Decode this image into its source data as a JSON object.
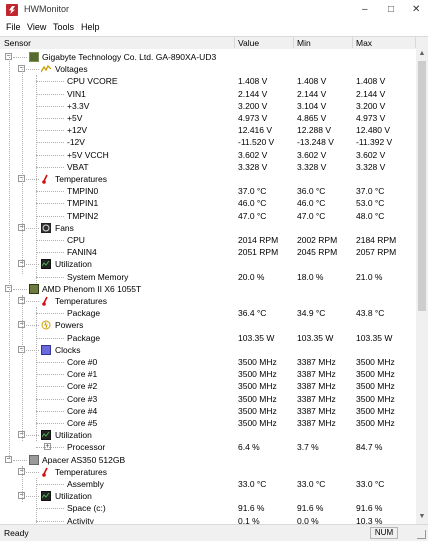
{
  "window": {
    "title": "HWMonitor"
  },
  "menu": [
    "File",
    "View",
    "Tools",
    "Help"
  ],
  "columns": {
    "sensor": "Sensor",
    "value": "Value",
    "min": "Min",
    "max": "Max"
  },
  "rows": [
    {
      "level": 1,
      "icon": "motherboard-icon",
      "label": "Gigabyte Technology Co. Ltd. GA-890XA-UD3",
      "value": "",
      "min": "",
      "max": "",
      "toggle": "–"
    },
    {
      "level": 2,
      "icon": "voltage-icon",
      "label": "Voltages",
      "value": "",
      "min": "",
      "max": "",
      "toggle": "–"
    },
    {
      "level": 3,
      "icon": "",
      "label": "CPU VCORE",
      "value": "1.408 V",
      "min": "1.408 V",
      "max": "1.408 V"
    },
    {
      "level": 3,
      "icon": "",
      "label": "VIN1",
      "value": "2.144 V",
      "min": "2.144 V",
      "max": "2.144 V"
    },
    {
      "level": 3,
      "icon": "",
      "label": "+3.3V",
      "value": "3.200 V",
      "min": "3.104 V",
      "max": "3.200 V"
    },
    {
      "level": 3,
      "icon": "",
      "label": "+5V",
      "value": "4.973 V",
      "min": "4.865 V",
      "max": "4.973 V"
    },
    {
      "level": 3,
      "icon": "",
      "label": "+12V",
      "value": "12.416 V",
      "min": "12.288 V",
      "max": "12.480 V"
    },
    {
      "level": 3,
      "icon": "",
      "label": "-12V",
      "value": "-11.520 V",
      "min": "-13.248 V",
      "max": "-11.392 V"
    },
    {
      "level": 3,
      "icon": "",
      "label": "+5V VCCH",
      "value": "3.602 V",
      "min": "3.602 V",
      "max": "3.602 V"
    },
    {
      "level": 3,
      "icon": "",
      "label": "VBAT",
      "value": "3.328 V",
      "min": "3.328 V",
      "max": "3.328 V"
    },
    {
      "level": 2,
      "icon": "thermometer-icon",
      "label": "Temperatures",
      "value": "",
      "min": "",
      "max": "",
      "toggle": "–"
    },
    {
      "level": 3,
      "icon": "",
      "label": "TMPIN0",
      "value": "37.0 °C",
      "min": "36.0 °C",
      "max": "37.0 °C"
    },
    {
      "level": 3,
      "icon": "",
      "label": "TMPIN1",
      "value": "46.0 °C",
      "min": "46.0 °C",
      "max": "53.0 °C"
    },
    {
      "level": 3,
      "icon": "",
      "label": "TMPIN2",
      "value": "47.0 °C",
      "min": "47.0 °C",
      "max": "48.0 °C"
    },
    {
      "level": 2,
      "icon": "fan-icon",
      "label": "Fans",
      "value": "",
      "min": "",
      "max": "",
      "toggle": "–"
    },
    {
      "level": 3,
      "icon": "",
      "label": "CPU",
      "value": "2014 RPM",
      "min": "2002 RPM",
      "max": "2184 RPM"
    },
    {
      "level": 3,
      "icon": "",
      "label": "FANIN4",
      "value": "2051 RPM",
      "min": "2045 RPM",
      "max": "2057 RPM"
    },
    {
      "level": 2,
      "icon": "utilization-icon",
      "label": "Utilization",
      "value": "",
      "min": "",
      "max": "",
      "toggle": "–"
    },
    {
      "level": 3,
      "icon": "",
      "label": "System Memory",
      "value": "20.0 %",
      "min": "18.0 %",
      "max": "21.0 %"
    },
    {
      "level": 1,
      "icon": "cpu-icon",
      "label": "AMD Phenom II X6 1055T",
      "value": "",
      "min": "",
      "max": "",
      "toggle": "–"
    },
    {
      "level": 2,
      "icon": "thermometer-icon",
      "label": "Temperatures",
      "value": "",
      "min": "",
      "max": "",
      "toggle": "–"
    },
    {
      "level": 3,
      "icon": "",
      "label": "Package",
      "value": "36.4 °C",
      "min": "34.9 °C",
      "max": "43.8 °C"
    },
    {
      "level": 2,
      "icon": "power-icon",
      "label": "Powers",
      "value": "",
      "min": "",
      "max": "",
      "toggle": "–"
    },
    {
      "level": 3,
      "icon": "",
      "label": "Package",
      "value": "103.35 W",
      "min": "103.35 W",
      "max": "103.35 W"
    },
    {
      "level": 2,
      "icon": "clock-icon",
      "label": "Clocks",
      "value": "",
      "min": "",
      "max": "",
      "toggle": "–"
    },
    {
      "level": 3,
      "icon": "",
      "label": "Core #0",
      "value": "3500 MHz",
      "min": "3387 MHz",
      "max": "3500 MHz"
    },
    {
      "level": 3,
      "icon": "",
      "label": "Core #1",
      "value": "3500 MHz",
      "min": "3387 MHz",
      "max": "3500 MHz"
    },
    {
      "level": 3,
      "icon": "",
      "label": "Core #2",
      "value": "3500 MHz",
      "min": "3387 MHz",
      "max": "3500 MHz"
    },
    {
      "level": 3,
      "icon": "",
      "label": "Core #3",
      "value": "3500 MHz",
      "min": "3387 MHz",
      "max": "3500 MHz"
    },
    {
      "level": 3,
      "icon": "",
      "label": "Core #4",
      "value": "3500 MHz",
      "min": "3387 MHz",
      "max": "3500 MHz"
    },
    {
      "level": 3,
      "icon": "",
      "label": "Core #5",
      "value": "3500 MHz",
      "min": "3387 MHz",
      "max": "3500 MHz"
    },
    {
      "level": 2,
      "icon": "utilization-icon",
      "label": "Utilization",
      "value": "",
      "min": "",
      "max": "",
      "toggle": "–"
    },
    {
      "level": 3,
      "icon": "",
      "label": "Processor",
      "value": "6.4 %",
      "min": "3.7 %",
      "max": "84.7 %",
      "toggle": "+"
    },
    {
      "level": 1,
      "icon": "disk-icon",
      "label": "Apacer AS350 512GB",
      "value": "",
      "min": "",
      "max": "",
      "toggle": "–"
    },
    {
      "level": 2,
      "icon": "thermometer-icon",
      "label": "Temperatures",
      "value": "",
      "min": "",
      "max": "",
      "toggle": "–"
    },
    {
      "level": 3,
      "icon": "",
      "label": "Assembly",
      "value": "33.0 °C",
      "min": "33.0 °C",
      "max": "33.0 °C"
    },
    {
      "level": 2,
      "icon": "utilization-icon",
      "label": "Utilization",
      "value": "",
      "min": "",
      "max": "",
      "toggle": "–"
    },
    {
      "level": 3,
      "icon": "",
      "label": "Space (c:)",
      "value": "91.6 %",
      "min": "91.6 %",
      "max": "91.6 %"
    },
    {
      "level": 3,
      "icon": "",
      "label": "Activity",
      "value": "0.1 %",
      "min": "0.0 %",
      "max": "10.3 %"
    }
  ],
  "status": {
    "text": "Ready",
    "num": "NUM"
  }
}
